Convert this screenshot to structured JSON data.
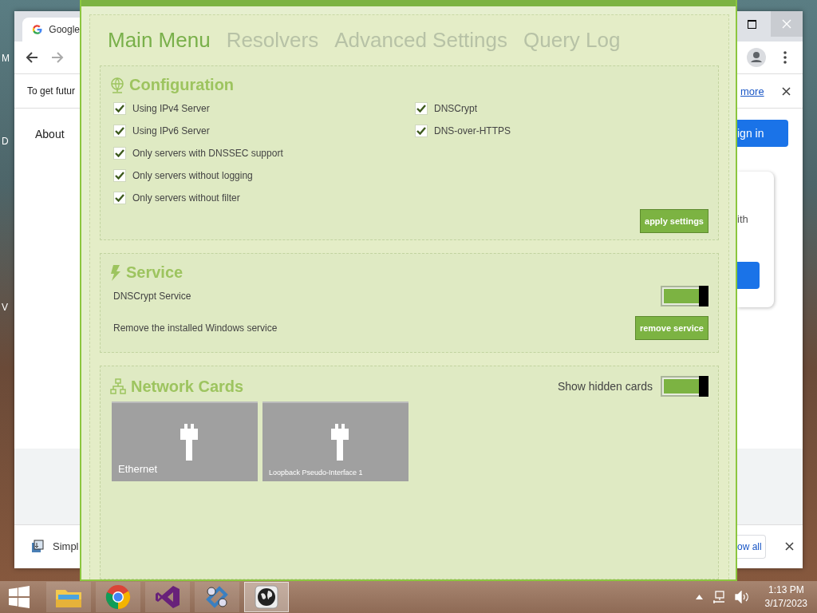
{
  "desktop": {
    "labels": [
      "M",
      "D",
      "V"
    ]
  },
  "browser": {
    "tab_title": "Google",
    "info_text": "To get futur",
    "info_link": "more",
    "nav_link": "About",
    "sign_in": "ign in",
    "card_text": "ith",
    "download_name": "Simpl",
    "show_all": "ow all"
  },
  "app": {
    "tabs": [
      {
        "label": "Main Menu",
        "selected": true
      },
      {
        "label": "Resolvers",
        "selected": false
      },
      {
        "label": "Advanced Settings",
        "selected": false
      },
      {
        "label": "Query Log",
        "selected": false
      }
    ],
    "configuration": {
      "title": "Configuration",
      "options": [
        {
          "label": "Using IPv4 Server",
          "checked": true
        },
        {
          "label": "Using IPv6 Server",
          "checked": true
        },
        {
          "label": "Only servers with DNSSEC support",
          "checked": true
        },
        {
          "label": "Only servers without logging",
          "checked": true
        },
        {
          "label": "Only servers without filter",
          "checked": true
        },
        {
          "label": "DNSCrypt",
          "checked": true
        },
        {
          "label": "DNS-over-HTTPS",
          "checked": true
        }
      ],
      "apply_button": "apply settings"
    },
    "service": {
      "title": "Service",
      "toggle_label": "DNSCrypt Service",
      "toggle_on": true,
      "remove_label": "Remove the installed Windows service",
      "remove_button": "remove service"
    },
    "network": {
      "title": "Network Cards",
      "show_hidden_label": "Show hidden cards",
      "show_hidden_on": true,
      "cards": [
        {
          "name": "Ethernet"
        },
        {
          "name": "Loopback Pseudo-Interface 1"
        }
      ]
    }
  },
  "taskbar": {
    "apps": [
      {
        "kind": "folder",
        "selected": false
      },
      {
        "kind": "chrome",
        "selected": false
      },
      {
        "kind": "studio",
        "selected": false
      },
      {
        "kind": "gears",
        "selected": false
      },
      {
        "kind": "globe",
        "selected": true
      }
    ],
    "time": "1:13 PM",
    "date": "3/17/2023"
  }
}
